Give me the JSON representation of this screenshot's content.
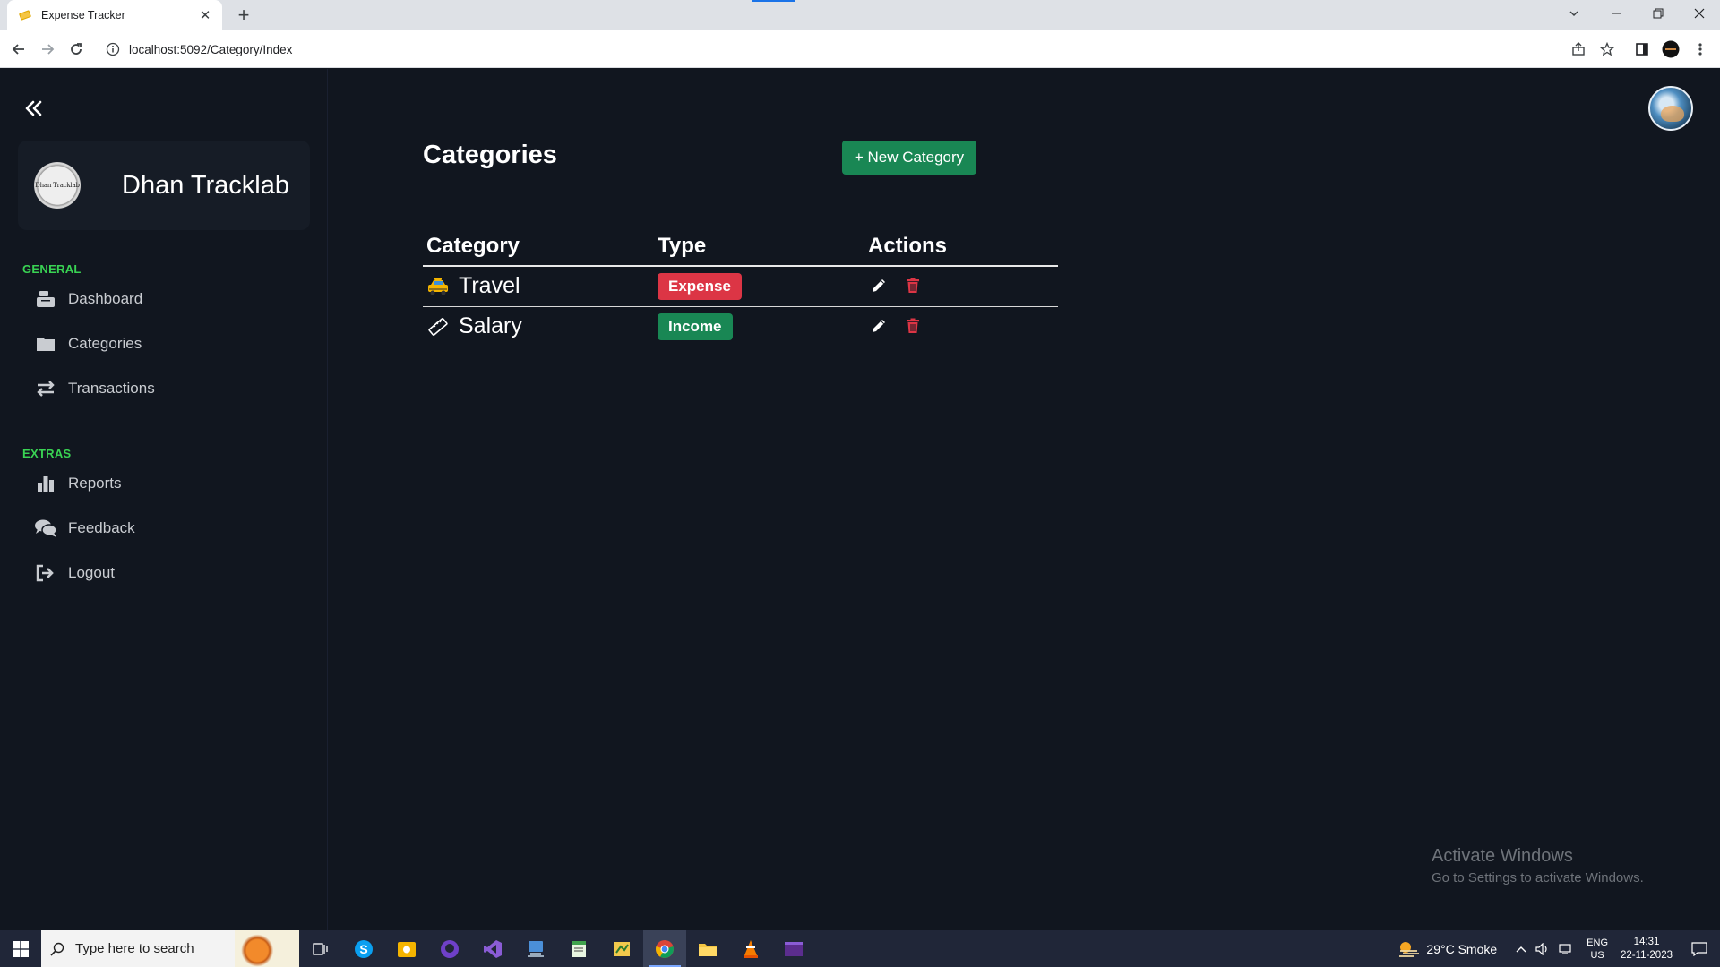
{
  "browser": {
    "tab_title": "Expense Tracker",
    "url": "localhost:5092/Category/Index"
  },
  "app": {
    "brand_name": "Dhan Tracklab",
    "logo_text": "Dhan Tracklab",
    "sidebar": {
      "sections": [
        {
          "label": "GENERAL",
          "items": [
            {
              "label": "Dashboard",
              "icon": "cash-register-icon"
            },
            {
              "label": "Categories",
              "icon": "folder-icon"
            },
            {
              "label": "Transactions",
              "icon": "arrows-exchange-icon"
            }
          ]
        },
        {
          "label": "EXTRAS",
          "items": [
            {
              "label": "Reports",
              "icon": "bar-chart-icon"
            },
            {
              "label": "Feedback",
              "icon": "comments-icon"
            },
            {
              "label": "Logout",
              "icon": "logout-icon"
            }
          ]
        }
      ]
    },
    "main": {
      "title": "Categories",
      "new_button": "+ New Category",
      "table": {
        "columns": [
          "Category",
          "Type",
          "Actions"
        ],
        "rows": [
          {
            "icon": "🚖",
            "name": "Travel",
            "type": "Expense"
          },
          {
            "icon": "📏",
            "name": "Salary",
            "type": "Income"
          }
        ]
      }
    },
    "watermark": {
      "line1": "Activate Windows",
      "line2": "Go to Settings to activate Windows."
    }
  },
  "taskbar": {
    "search_placeholder": "Type here to search",
    "weather": "29°C  Smoke",
    "lang_top": "ENG",
    "lang_bottom": "US",
    "time": "14:31",
    "date": "22-11-2023"
  },
  "colors": {
    "background": "#11161f",
    "accent_green": "#198754",
    "section_label": "#39d353",
    "expense_red": "#dc3545",
    "delete_red": "#dc3545"
  }
}
